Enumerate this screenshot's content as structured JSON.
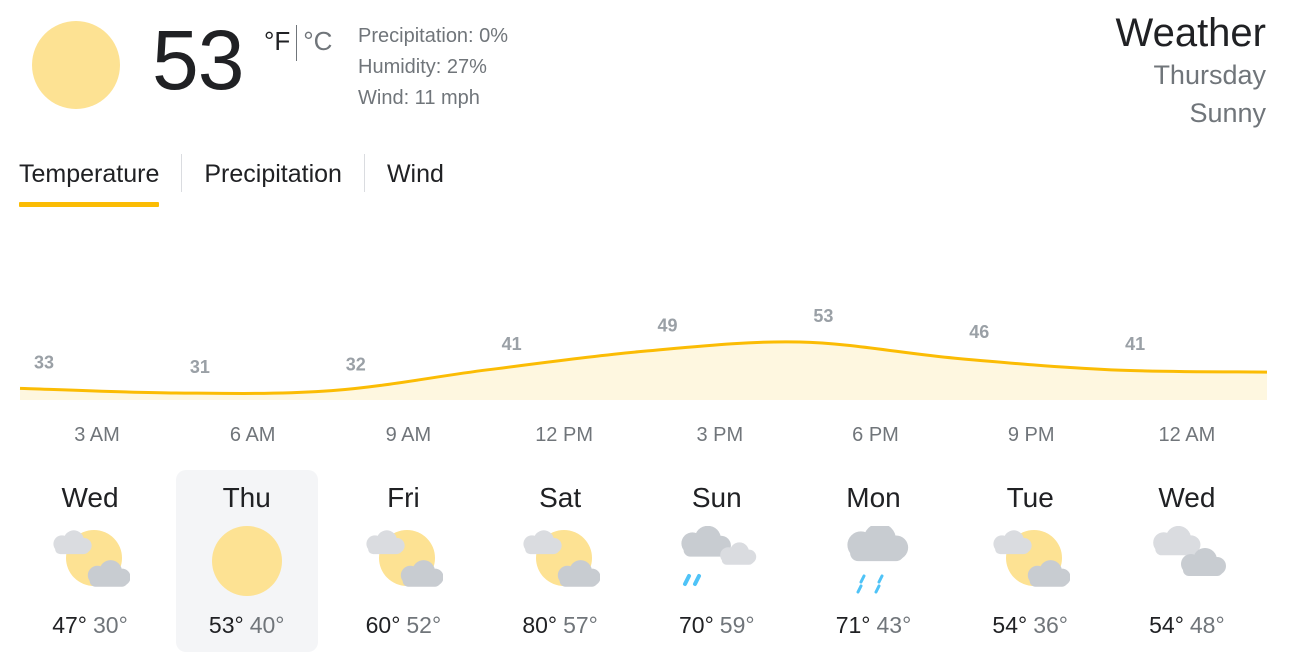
{
  "current": {
    "temp": "53",
    "unit_f": "°F",
    "unit_c": "°C",
    "icon": "sun-icon",
    "details": [
      "Precipitation: 0%",
      "Humidity: 27%",
      "Wind: 11 mph"
    ]
  },
  "header": {
    "title": "Weather",
    "day": "Thursday",
    "condition": "Sunny"
  },
  "tabs": [
    {
      "label": "Temperature",
      "active": true
    },
    {
      "label": "Precipitation",
      "active": false
    },
    {
      "label": "Wind",
      "active": false
    }
  ],
  "chart_data": {
    "type": "area",
    "series": [
      {
        "x": [
          "12AM",
          "3AM",
          "6AM",
          "9AM",
          "12PM",
          "3PM",
          "6PM",
          "9PM",
          "12AM"
        ],
        "values": [
          33,
          31,
          32,
          41,
          49,
          53,
          46,
          41,
          40
        ]
      }
    ],
    "labeled_points": [
      {
        "label": "33",
        "value": 33
      },
      {
        "label": "31",
        "value": 31
      },
      {
        "label": "32",
        "value": 32
      },
      {
        "label": "41",
        "value": 41
      },
      {
        "label": "49",
        "value": 49
      },
      {
        "label": "53",
        "value": 53
      },
      {
        "label": "46",
        "value": 46
      },
      {
        "label": "41",
        "value": 41
      }
    ],
    "time_labels": [
      "3 AM",
      "6 AM",
      "9 AM",
      "12 PM",
      "3 PM",
      "6 PM",
      "9 PM",
      "12 AM"
    ],
    "colors": {
      "line": "#fbbc04",
      "fill": "#fef7e0"
    }
  },
  "forecast": [
    {
      "day": "Wed",
      "icon": "partly-cloudy-icon",
      "hi": "47°",
      "lo": "30°",
      "selected": false
    },
    {
      "day": "Thu",
      "icon": "sun-icon",
      "hi": "53°",
      "lo": "40°",
      "selected": true
    },
    {
      "day": "Fri",
      "icon": "partly-cloudy-icon",
      "hi": "60°",
      "lo": "52°",
      "selected": false
    },
    {
      "day": "Sat",
      "icon": "partly-cloudy-icon",
      "hi": "80°",
      "lo": "57°",
      "selected": false
    },
    {
      "day": "Sun",
      "icon": "rain-showers-icon",
      "hi": "70°",
      "lo": "59°",
      "selected": false
    },
    {
      "day": "Mon",
      "icon": "rain-icon",
      "hi": "71°",
      "lo": "43°",
      "selected": false
    },
    {
      "day": "Tue",
      "icon": "partly-cloudy-icon",
      "hi": "54°",
      "lo": "36°",
      "selected": false
    },
    {
      "day": "Wed",
      "icon": "cloudy-icon",
      "hi": "54°",
      "lo": "48°",
      "selected": false
    }
  ],
  "colors": {
    "accent": "#fbbc04",
    "sun": "#fde293",
    "cloud": "#dadce0",
    "rain": "#4fc3f7"
  }
}
